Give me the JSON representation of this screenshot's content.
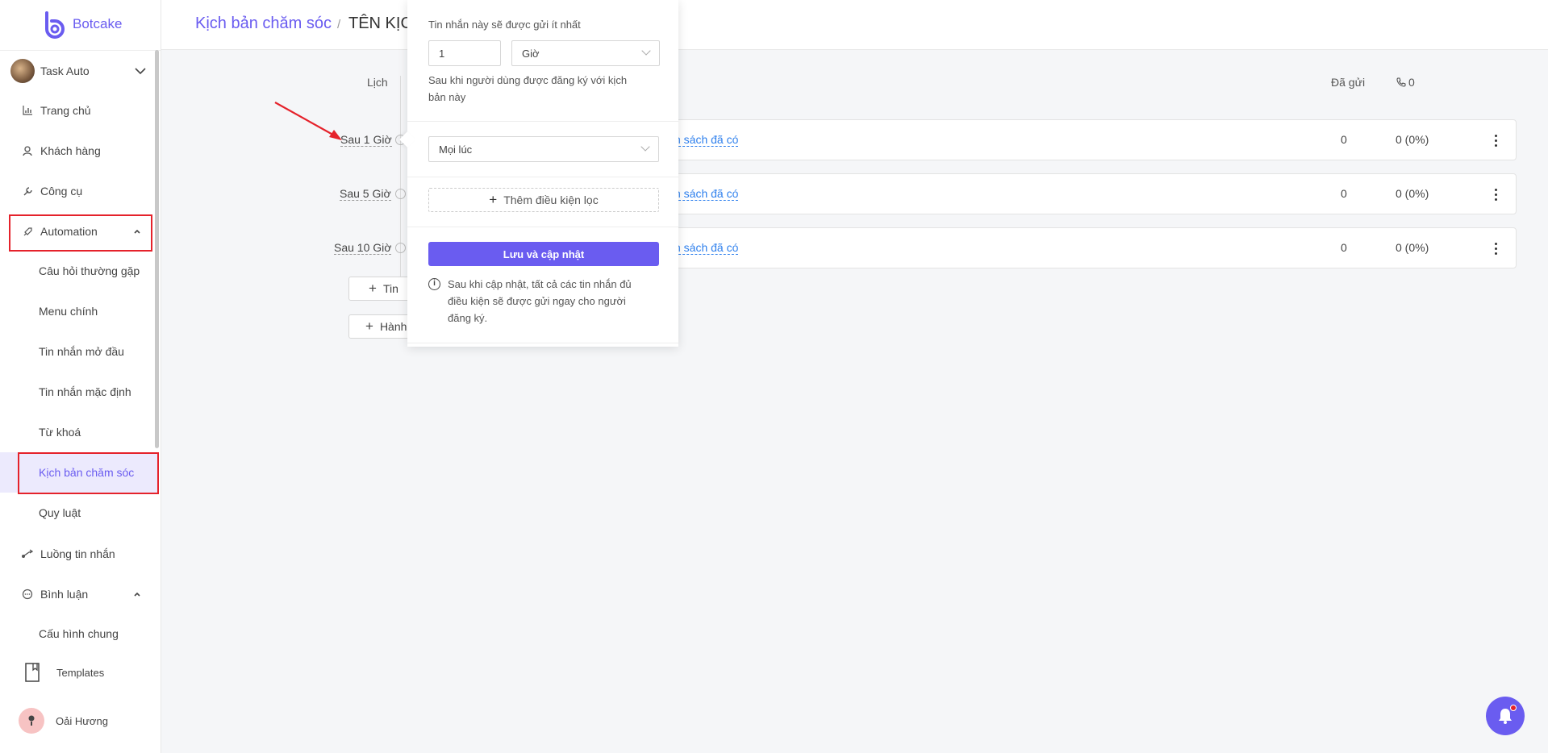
{
  "app": {
    "name": "Botcake"
  },
  "sidebar": {
    "account": {
      "name": "Task Auto"
    },
    "items": [
      {
        "label": "Trang chủ"
      },
      {
        "label": "Khách hàng"
      },
      {
        "label": "Công cụ"
      },
      {
        "label": "Automation"
      },
      {
        "label": "Luồng tin nhắn"
      },
      {
        "label": "Bình luận"
      }
    ],
    "automation_sub": [
      {
        "label": "Câu hỏi thường gặp"
      },
      {
        "label": "Menu chính"
      },
      {
        "label": "Tin nhắn mở đầu"
      },
      {
        "label": "Tin nhắn mặc định"
      },
      {
        "label": "Từ khoá"
      },
      {
        "label": "Kịch bản chăm sóc"
      },
      {
        "label": "Quy luật"
      }
    ],
    "comment_sub": [
      {
        "label": "Cấu hình chung"
      }
    ],
    "templates": {
      "label": "Templates"
    },
    "user": {
      "name": "Oải Hương"
    }
  },
  "header": {
    "breadcrumb_parent": "Kịch bản chăm sóc",
    "breadcrumb_sep": "/",
    "breadcrumb_current": "TÊN KỊC"
  },
  "main": {
    "col_schedule": "Lịch",
    "col_sent": "Đã gửi",
    "col_calls": "0",
    "rows": [
      {
        "delay": "Sau 1 Giờ",
        "link": "n sách đã có",
        "sent": "0",
        "rate": "0 (0%)"
      },
      {
        "delay": "Sau 5 Giờ",
        "link": "n sách đã có",
        "sent": "0",
        "rate": "0 (0%)"
      },
      {
        "delay": "Sau 10 Giờ",
        "link": "n sách đã có",
        "sent": "0",
        "rate": "0 (0%)"
      }
    ],
    "add_message": "Tin",
    "add_action": "Hành"
  },
  "popover": {
    "intro": "Tin nhắn này sẽ được gửi ít nhất",
    "amount_value": "1",
    "unit_value": "Giờ",
    "after_line1": "Sau khi người dùng được đăng ký với kịch",
    "after_line2": "bản này",
    "time_select": "Mọi lúc",
    "add_filter": "Thêm điều kiện lọc",
    "save_button": "Lưu và cập nhật",
    "note_line1": "Sau khi cập nhật, tất cả các tin nhắn đủ",
    "note_line2": "điều kiện sẽ được gửi ngay cho người",
    "note_line3": "đăng ký."
  },
  "colors": {
    "accent": "#6a5cf0",
    "link": "#2f80ed",
    "highlight": "#e5222b"
  }
}
